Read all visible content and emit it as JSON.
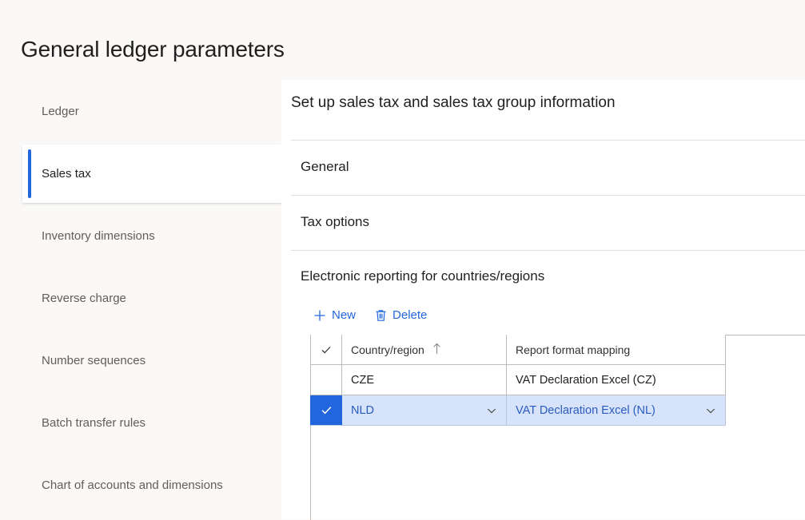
{
  "page": {
    "title": "General ledger parameters",
    "background_color": "#faf9f8",
    "accent_color": "#2266dd"
  },
  "sidebar": {
    "items": [
      {
        "label": "Ledger",
        "selected": false
      },
      {
        "label": "Sales tax",
        "selected": true
      },
      {
        "label": "Inventory dimensions",
        "selected": false
      },
      {
        "label": "Reverse charge",
        "selected": false
      },
      {
        "label": "Number sequences",
        "selected": false
      },
      {
        "label": "Batch transfer rules",
        "selected": false
      },
      {
        "label": "Chart of accounts and dimensions",
        "selected": false
      }
    ]
  },
  "content": {
    "title": "Set up sales tax and sales tax group information",
    "sections": [
      {
        "label": "General"
      },
      {
        "label": "Tax options"
      },
      {
        "label": "Electronic reporting for countries/regions"
      }
    ]
  },
  "toolbar": {
    "new_label": "New",
    "new_icon": "plus-icon",
    "delete_label": "Delete",
    "delete_icon": "trash-icon"
  },
  "grid": {
    "columns": [
      {
        "key": "select",
        "label": "",
        "icon": "checkmark-icon"
      },
      {
        "key": "country",
        "label": "Country/region",
        "sort": "ascending",
        "sort_icon": "arrow-up-icon"
      },
      {
        "key": "mapping",
        "label": "Report format mapping"
      }
    ],
    "rows": [
      {
        "selected": false,
        "country": "CZE",
        "mapping": "VAT Declaration Excel (CZ)"
      },
      {
        "selected": true,
        "country": "NLD",
        "mapping": "VAT Declaration Excel (NL)"
      }
    ]
  }
}
